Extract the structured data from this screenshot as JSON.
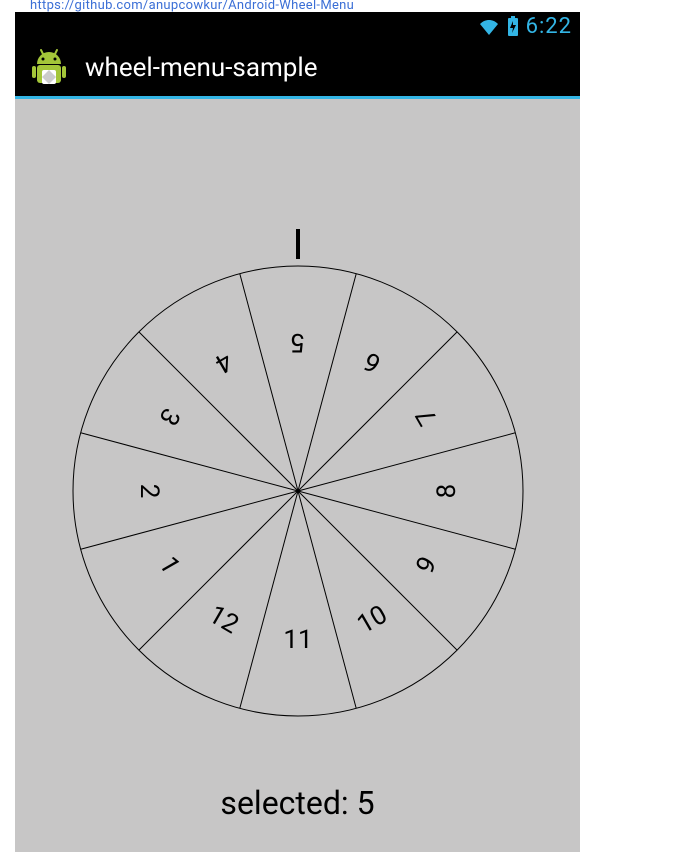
{
  "crumb_url": "https://github.com/anupcowkur/Android-Wheel-Menu",
  "status": {
    "time": "6:22"
  },
  "app": {
    "title": "wheel-menu-sample"
  },
  "wheel": {
    "segments": [
      "5",
      "6",
      "7",
      "8",
      "9",
      "10",
      "11",
      "12",
      "1",
      "2",
      "3",
      "4"
    ],
    "selected_prefix": "selected:",
    "selected_value": "5"
  },
  "colors": {
    "accent": "#33b5e5",
    "bg": "#c7c6c6"
  }
}
